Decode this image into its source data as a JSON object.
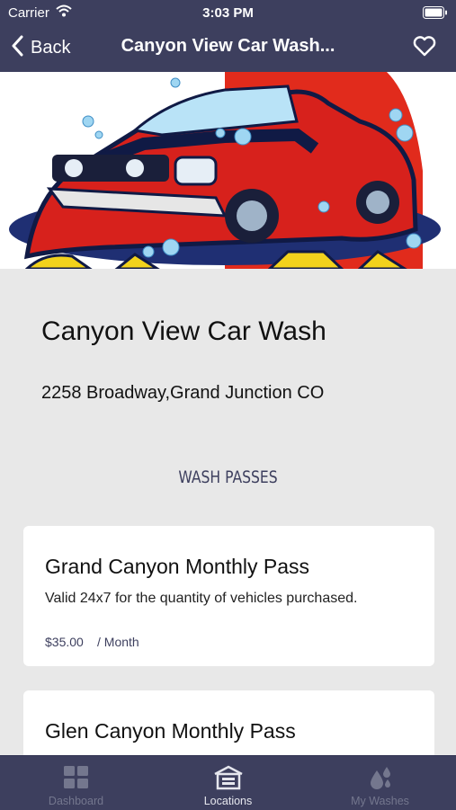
{
  "status_bar": {
    "carrier": "Carrier",
    "time": "3:03 PM"
  },
  "nav": {
    "back_label": "Back",
    "title": "Canyon View Car Wash..."
  },
  "location": {
    "name": "Canyon View Car Wash",
    "address": "2258 Broadway,Grand Junction CO"
  },
  "section": {
    "heading": "WASH PASSES"
  },
  "passes": [
    {
      "title": "Grand Canyon Monthly Pass",
      "description": "Valid 24x7 for the quantity of vehicles purchased.",
      "price": "$35.00",
      "period": "/ Month"
    },
    {
      "title": "Glen Canyon Monthly Pass"
    }
  ],
  "tabs": [
    {
      "label": "Dashboard",
      "icon": "dashboard-icon",
      "active": false
    },
    {
      "label": "Locations",
      "icon": "locations-icon",
      "active": true
    },
    {
      "label": "My Washes",
      "icon": "my-washes-icon",
      "active": false
    }
  ],
  "colors": {
    "nav_bg": "#3d3f5e",
    "page_bg": "#e8e8e8",
    "accent": "#3d3f5e"
  }
}
